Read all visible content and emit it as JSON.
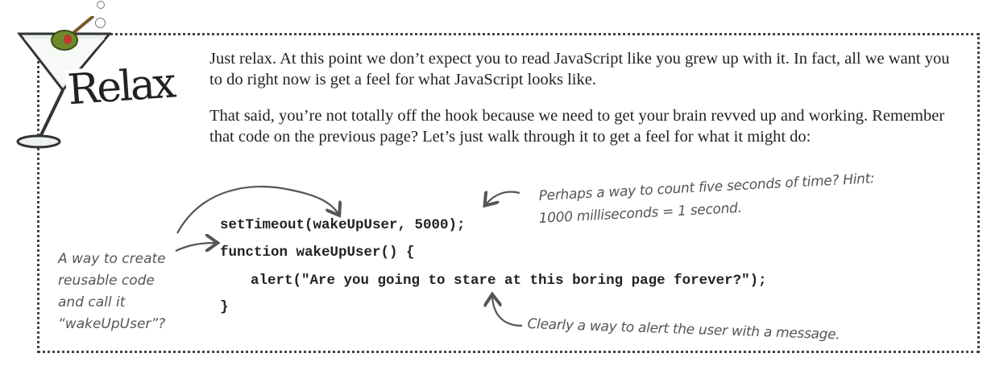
{
  "sidebar_title": "Relax",
  "paragraphs": [
    "Just relax. At this point we don’t expect you to read JavaScript like you grew up with it. In fact, all we want you to do right now is get a feel for what JavaScript looks like.",
    "That said, you’re not totally off the hook because we need to get your brain revved up and working. Remember that code on the previous page? Let’s just walk through it to get a feel for what it might do:"
  ],
  "code_lines": [
    "setTimeout(wakeUpUser, 5000);",
    "function wakeUpUser() {",
    "alert(\"Are you going to stare at this boring page forever?\");",
    "}"
  ],
  "annotations": {
    "timeout_line1": "Perhaps a way to count five seconds of time? Hint:",
    "timeout_line2": "1000 milliseconds = 1 second.",
    "function_lines": [
      "A way to create",
      "reusable code",
      "and call it",
      "“wakeUpUser”?"
    ],
    "alert_note": "Clearly a way to alert the user with a message."
  },
  "colors": {
    "olive": "#6f8a2e",
    "pimento": "#c0392b",
    "border": "#444444"
  },
  "icons": [
    "martini-glass-icon"
  ]
}
